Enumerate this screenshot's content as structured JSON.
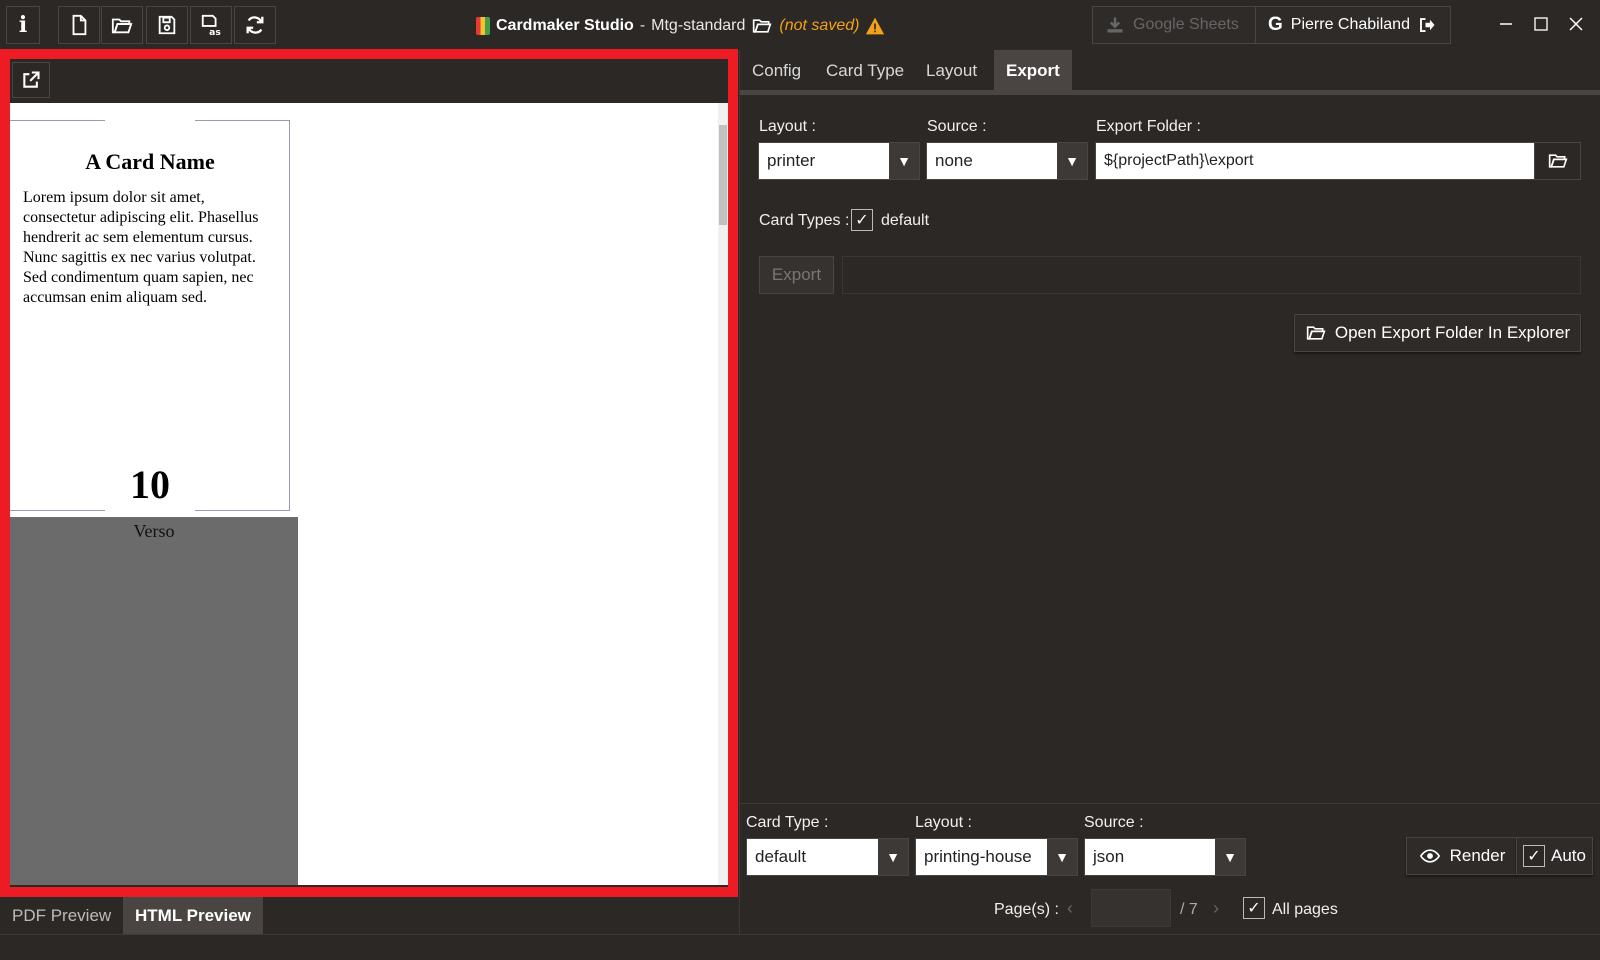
{
  "titlebar": {
    "app_name": "Cardmaker Studio",
    "separator": "-",
    "project_name": "Mtg-standard",
    "save_state": "(not saved)",
    "google_sheets_label": "Google Sheets",
    "user_name": "Pierre Chabiland",
    "icons": [
      "info-icon",
      "new-file-icon",
      "open-folder-icon",
      "save-icon",
      "save-as-icon",
      "refresh-icon",
      "folder-outline-icon",
      "warning-icon",
      "download-icon",
      "google-icon",
      "logout-icon",
      "minimize-icon",
      "maximize-icon",
      "close-icon"
    ]
  },
  "preview": {
    "card": {
      "name": "A Card Name",
      "body": "Lorem ipsum dolor sit amet, consectetur adipiscing elit. Phasellus hendrerit ac sem elementum cursus. Nunc sagittis ex nec varius volutpat. Sed condimentum quam sapien, nec accumsan enim aliquam sed.",
      "value": "10"
    },
    "verso_label": "Verso",
    "tabs": [
      {
        "label": "PDF Preview",
        "active": false
      },
      {
        "label": "HTML Preview",
        "active": true
      }
    ]
  },
  "right_tabs": [
    {
      "label": "Config",
      "active": false
    },
    {
      "label": "Card Type",
      "active": false
    },
    {
      "label": "Layout",
      "active": false
    },
    {
      "label": "Export",
      "active": true
    }
  ],
  "export": {
    "layout_label": "Layout :",
    "layout_value": "printer",
    "source_label": "Source :",
    "source_value": "none",
    "folder_label": "Export Folder :",
    "folder_value": "${projectPath}\\export",
    "card_types_label": "Card Types :",
    "card_types": [
      {
        "label": "default",
        "checked": true
      }
    ],
    "export_button": "Export",
    "open_folder_button": "Open Export Folder In Explorer"
  },
  "render_bar": {
    "card_type_label": "Card Type :",
    "card_type_value": "default",
    "layout_label": "Layout :",
    "layout_value": "printing-house",
    "source_label": "Source :",
    "source_value": "json",
    "render_button": "Render",
    "auto_label": "Auto",
    "auto_checked": true,
    "pages_label": "Page(s) :",
    "pages_total": "/ 7",
    "all_pages_label": "All pages",
    "all_pages_checked": true
  },
  "colors": {
    "background": "#2c2826",
    "highlight_border": "#ed1c24",
    "warning": "#f5a01a",
    "active_tab": "#4a4542"
  }
}
